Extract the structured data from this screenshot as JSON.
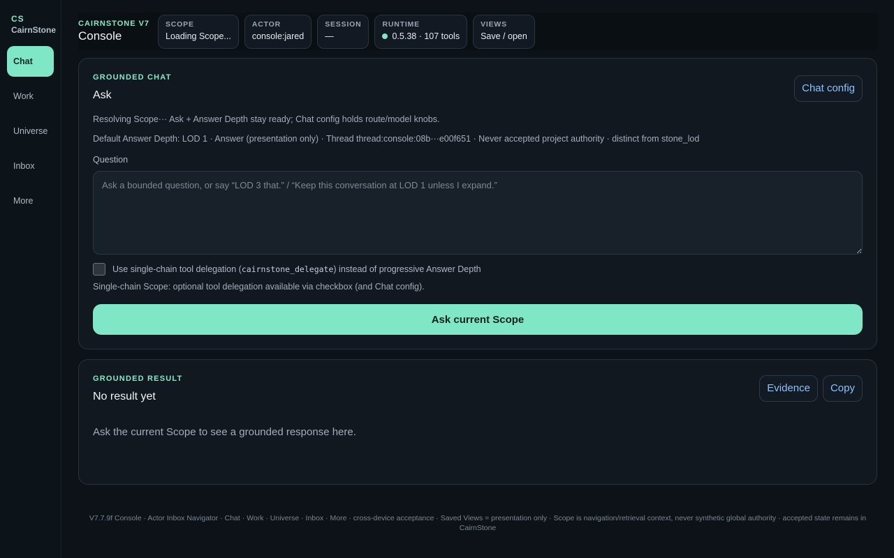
{
  "brand": {
    "abbr": "CS",
    "name": "CairnStone"
  },
  "sidebar": {
    "items": [
      {
        "label": "Chat",
        "active": true
      },
      {
        "label": "Work",
        "active": false
      },
      {
        "label": "Universe",
        "active": false
      },
      {
        "label": "Inbox",
        "active": false
      },
      {
        "label": "More",
        "active": false
      }
    ]
  },
  "header": {
    "kicker": "CAIRNSTONE V7",
    "title": "Console",
    "chips": {
      "scope": {
        "label": "SCOPE",
        "value": "Loading Scope..."
      },
      "actor": {
        "label": "ACTOR",
        "value": "console:jared"
      },
      "session": {
        "label": "SESSION",
        "value": "—"
      },
      "runtime": {
        "label": "RUNTIME",
        "value": "0.5.38 · 107 tools"
      },
      "views": {
        "label": "VIEWS",
        "value": "Save / open"
      }
    }
  },
  "chat": {
    "kicker": "GROUNDED CHAT",
    "title": "Ask",
    "config_button": "Chat config",
    "status_line": "Resolving Scope··· Ask + Answer Depth stay ready; Chat config holds route/model knobs.",
    "depth_line": "Default Answer Depth: LOD 1 · Answer (presentation only) · Thread thread:console:08b···e00f651 · Never accepted project authority · distinct from stone_lod",
    "question_label": "Question",
    "question_value": "",
    "question_placeholder": "Ask a bounded question, or say “LOD 3 that.” / “Keep this conversation at LOD 1 unless I expand.”",
    "delegate_prefix": "Use single-chain tool delegation (",
    "delegate_code": "cairnstone_delegate",
    "delegate_suffix": ") instead of progressive Answer Depth",
    "delegate_checked": false,
    "note": "Single-chain Scope: optional tool delegation available via checkbox (and Chat config).",
    "ask_button": "Ask current Scope"
  },
  "result": {
    "kicker": "GROUNDED RESULT",
    "title": "No result yet",
    "evidence_button": "Evidence",
    "copy_button": "Copy",
    "empty_message": "Ask the current Scope to see a grounded response here."
  },
  "footer": {
    "text": "V7.7.9f Console · Actor Inbox Navigator · Chat · Work · Universe · Inbox · More · cross-device acceptance · Saved Views = presentation only · Scope is navigation/retrieval context, never synthetic global authority · accepted state remains in CairnStone"
  },
  "colors": {
    "accent": "#7fe6c6",
    "link": "#8fc0ff",
    "background": "#0d1218"
  }
}
